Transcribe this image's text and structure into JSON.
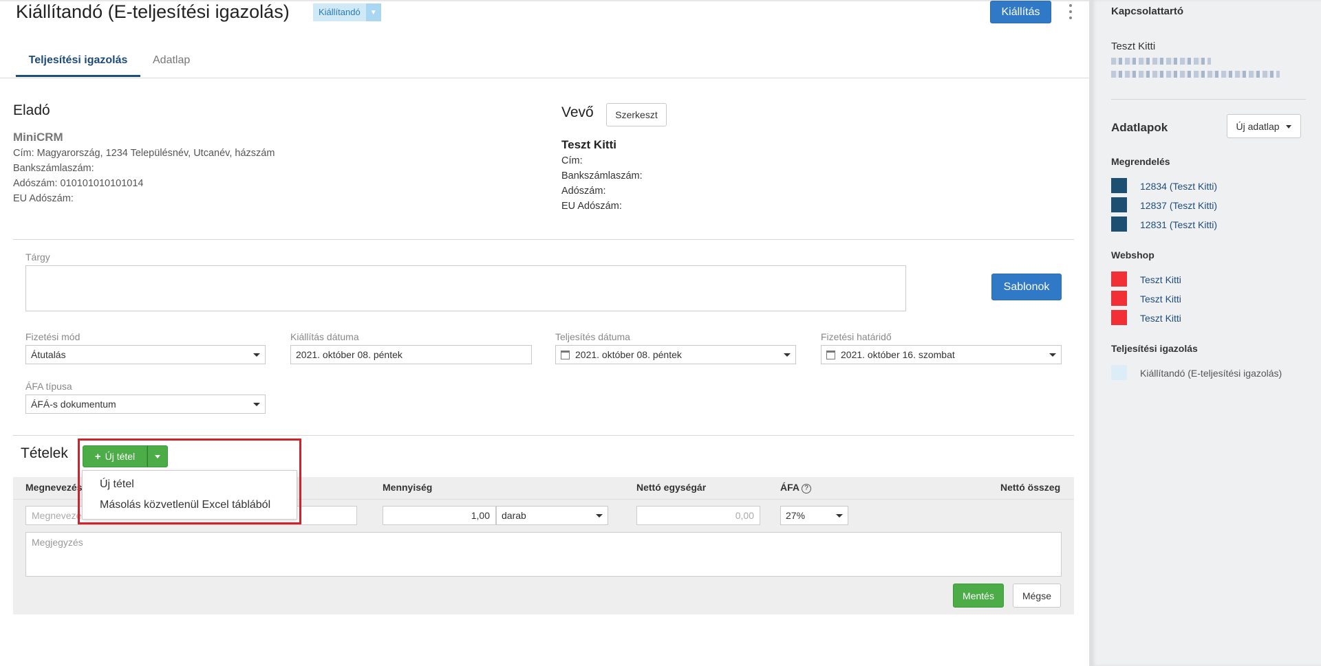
{
  "header": {
    "title": "Kiállítandó (E-teljesítési igazolás)",
    "status_badge": "Kiállítandó",
    "issue_button": "Kiállítás"
  },
  "tabs": [
    {
      "label": "Teljesítési igazolás",
      "active": true
    },
    {
      "label": "Adatlap",
      "active": false
    }
  ],
  "seller": {
    "heading": "Eladó",
    "company": "MiniCRM",
    "address": "Cím: Magyarország, 1234 Településnév, Utcanév, házszám",
    "bank": "Bankszámlaszám:",
    "tax": "Adószám: 010101010101014",
    "eu_tax": "EU Adószám:"
  },
  "buyer": {
    "heading": "Vevő",
    "edit_button": "Szerkeszt",
    "name": "Teszt Kitti",
    "address": "Cím:",
    "bank": "Bankszámlaszám:",
    "tax": "Adószám:",
    "eu_tax": "EU Adószám:"
  },
  "form": {
    "subject_label": "Tárgy",
    "templates_button": "Sablonok",
    "payment_method_label": "Fizetési mód",
    "payment_method_value": "Átutalás",
    "issue_date_label": "Kiállítás dátuma",
    "issue_date_value": "2021. október 08. péntek",
    "fulfillment_date_label": "Teljesítés dátuma",
    "fulfillment_date_value": "2021. október 08. péntek",
    "due_date_label": "Fizetési határidő",
    "due_date_value": "2021. október 16. szombat",
    "vat_type_label": "ÁFA típusa",
    "vat_type_value": "ÁFÁ-s dokumentum"
  },
  "items": {
    "heading": "Tételek",
    "new_item_button": "Új tétel",
    "dropdown": [
      "Új tétel",
      "Másolás közvetlenül Excel táblából"
    ],
    "columns": {
      "name": "Megnevezés",
      "quantity": "Mennyiség",
      "unit_price": "Nettó egységár",
      "vat": "ÁFA",
      "net_total": "Nettó összeg"
    },
    "row": {
      "name_placeholder": "Megnevezés",
      "quantity": "1,00",
      "unit": "darab",
      "unit_price": "0,00",
      "vat": "27%"
    },
    "note_placeholder": "Megjegyzés",
    "save_button": "Mentés",
    "cancel_button": "Mégse"
  },
  "sidebar": {
    "contact_title": "Kapcsolattartó",
    "contact_name": "Teszt Kitti",
    "datasheets_title": "Adatlapok",
    "new_datasheet_button": "Új adatlap",
    "groups": [
      {
        "title": "Megrendelés",
        "color": "#1d4f73",
        "links": [
          "12834 (Teszt Kitti)",
          "12837 (Teszt Kitti)",
          "12831 (Teszt Kitti)"
        ]
      },
      {
        "title": "Webshop",
        "color": "#f22f35",
        "links": [
          "Teszt Kitti",
          "Teszt Kitti",
          "Teszt Kitti"
        ]
      },
      {
        "title": "Teljesítési igazolás",
        "color": "#dcedf8",
        "links": [
          "Kiállítandó (E-teljesítési igazolás)"
        ]
      }
    ]
  },
  "colors": {
    "primary": "#2f79c6",
    "success": "#4bac48",
    "highlight_border": "#d0222a",
    "link": "#1e4c7a"
  }
}
